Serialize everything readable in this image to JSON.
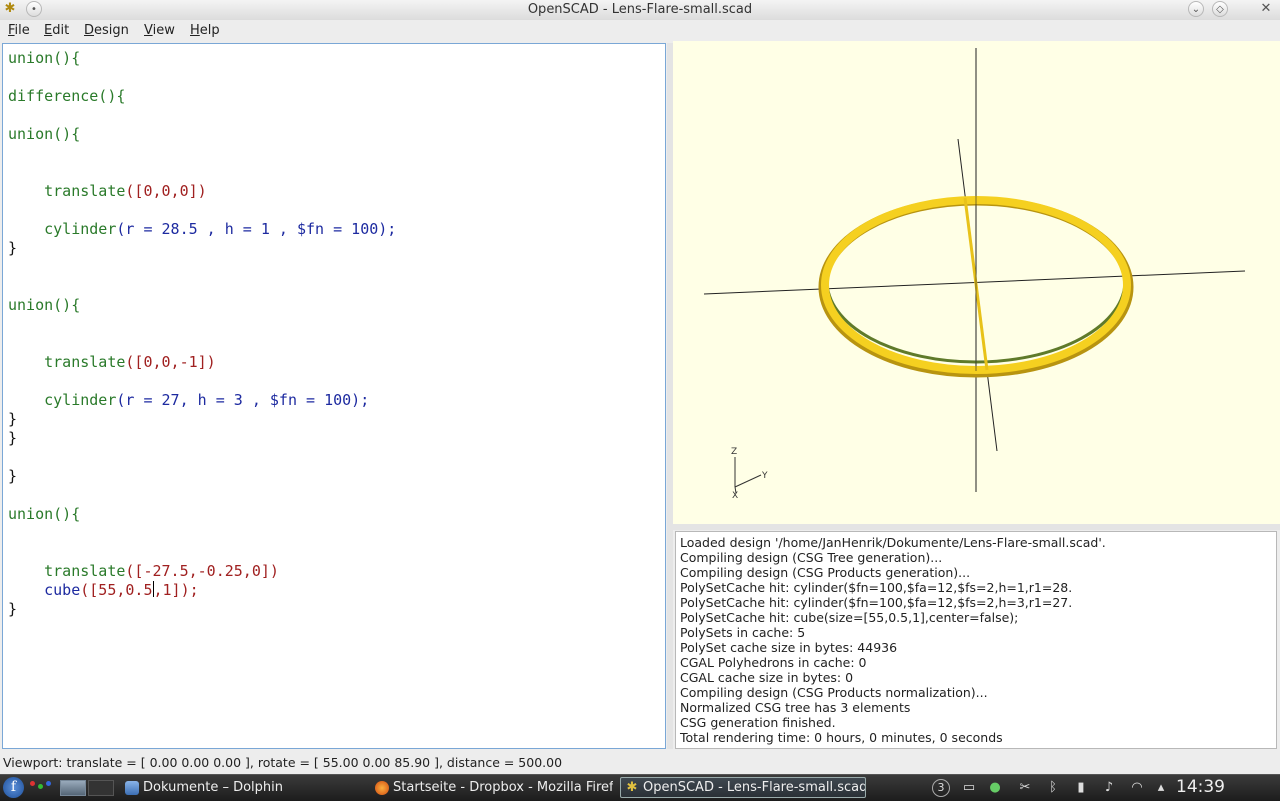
{
  "window": {
    "title": "OpenSCAD - Lens-Flare-small.scad"
  },
  "menu": [
    "File",
    "Edit",
    "Design",
    "View",
    "Help"
  ],
  "editor": {
    "line_01": "union(){",
    "line_02": "difference(){",
    "line_03": "union(){",
    "line_04_fn": "translate",
    "line_04_args": "([0,0,0])",
    "line_05_fn": "cylinder",
    "line_05_args": "(r = 28.5 , h = 1 , $fn = 100);",
    "line_06": "}",
    "line_07": "union(){",
    "line_08_fn": "translate",
    "line_08_args": "([0,0,-1])",
    "line_09_fn": "cylinder",
    "line_09_args": "(r = 27, h = 3 , $fn = 100);",
    "line_10": "}",
    "line_11": "}",
    "line_12": "}",
    "line_13": "union(){",
    "line_14_fn": "translate",
    "line_14_args": "([-27.5,-0.25,0])",
    "line_15_fn": "cube",
    "line_15_args_a": "([55,0.5",
    "line_15_args_b": ",1]);",
    "line_16": "}"
  },
  "viewport": {
    "axis_labels": {
      "z": "Z",
      "y": "Y",
      "x": "X"
    },
    "ring_color": "#f5d020",
    "background": "#ffffe6"
  },
  "console": {
    "lines": [
      "Loaded design '/home/JanHenrik/Dokumente/Lens-Flare-small.scad'.",
      "Compiling design (CSG Tree generation)...",
      "Compiling design (CSG Products generation)...",
      "PolySetCache hit: cylinder($fn=100,$fa=12,$fs=2,h=1,r1=28.",
      "PolySetCache hit: cylinder($fn=100,$fa=12,$fs=2,h=3,r1=27.",
      "PolySetCache hit: cube(size=[55,0.5,1],center=false);",
      "PolySets in cache: 5",
      "PolySet cache size in bytes: 44936",
      "CGAL Polyhedrons in cache: 0",
      "CGAL cache size in bytes: 0",
      "Compiling design (CSG Products normalization)...",
      "Normalized CSG tree has 3 elements",
      "CSG generation finished.",
      "Total rendering time: 0 hours, 0 minutes, 0 seconds"
    ]
  },
  "statusbar": {
    "text": "Viewport: translate = [ 0.00 0.00 0.00 ], rotate = [ 55.00 0.00 85.90 ], distance = 500.00"
  },
  "taskbar": {
    "tasks": [
      {
        "label": "Dokumente – Dolphin"
      },
      {
        "label": "Startseite - Dropbox - Mozilla Firefox"
      },
      {
        "label": "OpenSCAD - Lens-Flare-small.scad"
      }
    ],
    "tray_badge": "3",
    "clock": "14:39"
  }
}
